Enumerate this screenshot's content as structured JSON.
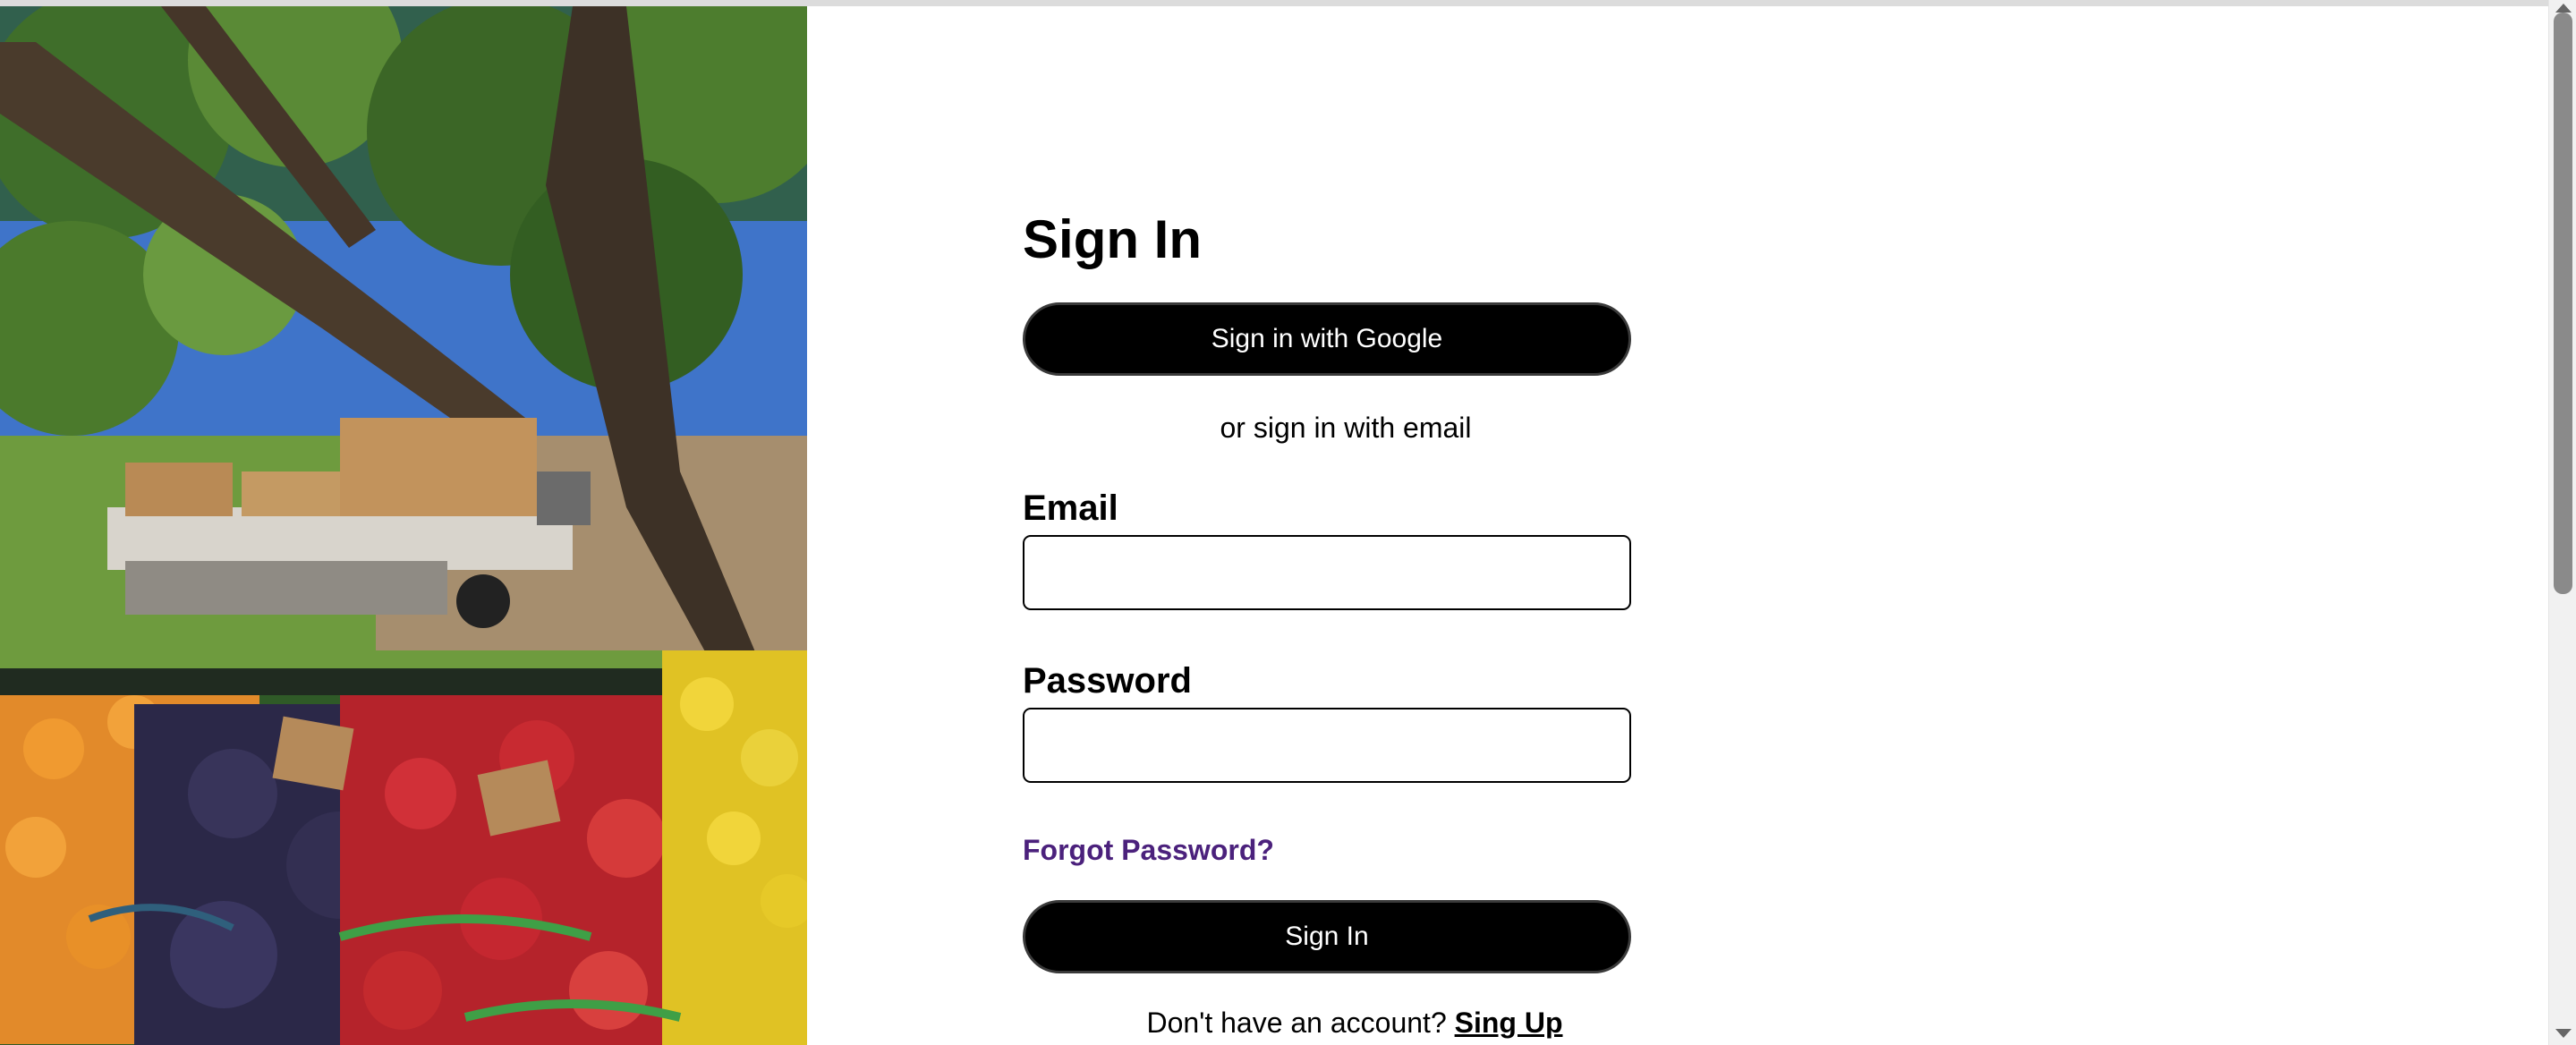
{
  "page": {
    "title": "Sign In"
  },
  "actions": {
    "google_label": "Sign in with Google",
    "divider_text": "or sign in with email",
    "signin_label": "Sign In"
  },
  "fields": {
    "email_label": "Email",
    "email_value": "",
    "password_label": "Password",
    "password_value": ""
  },
  "links": {
    "forgot_password": "Forgot Password?",
    "signup_prompt": "Don't have an account?",
    "signup_label": "Sing Up"
  },
  "colors": {
    "button_bg": "#000000",
    "button_text": "#ffffff",
    "link_purple": "#4b217c"
  }
}
